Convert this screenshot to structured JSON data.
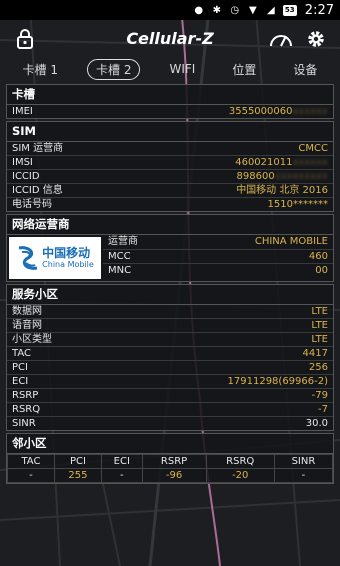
{
  "status_bar": {
    "time": "2:27",
    "battery": "53"
  },
  "app": {
    "title": "Cellular-Z"
  },
  "tabs": [
    {
      "label": "卡槽 1",
      "active": false
    },
    {
      "label": "卡槽 2",
      "active": true
    },
    {
      "label": "WIFI",
      "active": false
    },
    {
      "label": "位置",
      "active": false
    },
    {
      "label": "设备",
      "active": false
    }
  ],
  "slot": {
    "title": "卡槽",
    "imei_label": "IMEI",
    "imei_value": "3555000060",
    "imei_masked": "xxxxxx"
  },
  "sim": {
    "title": "SIM",
    "rows": [
      {
        "label": "SIM 运营商",
        "value": "CMCC",
        "masked": ""
      },
      {
        "label": "IMSI",
        "value": "460021011",
        "masked": "xxxxxx"
      },
      {
        "label": "ICCID",
        "value": "898600",
        "masked": "xxxxxxxxx"
      },
      {
        "label": "ICCID 信息",
        "value": "中国移动 北京 2016",
        "masked": ""
      },
      {
        "label": "电话号码",
        "value": "1510*******",
        "masked": ""
      }
    ]
  },
  "operator": {
    "title": "网络运营商",
    "logo_zh": "中国移动",
    "logo_en": "China Mobile",
    "rows": [
      {
        "label": "运营商",
        "value": "CHINA MOBILE"
      },
      {
        "label": "MCC",
        "value": "460"
      },
      {
        "label": "MNC",
        "value": "00"
      }
    ]
  },
  "serving": {
    "title": "服务小区",
    "rows": [
      {
        "label": "数据网",
        "value": "LTE"
      },
      {
        "label": "语音网",
        "value": "LTE"
      },
      {
        "label": "小区类型",
        "value": "LTE"
      },
      {
        "label": "TAC",
        "value": "4417"
      },
      {
        "label": "PCI",
        "value": "256"
      },
      {
        "label": "ECI",
        "value": "17911298(69966-2)"
      },
      {
        "label": "RSRP",
        "value": "-79"
      },
      {
        "label": "RSRQ",
        "value": "-7"
      },
      {
        "label": "SINR",
        "value": "30.0"
      }
    ]
  },
  "neighbor": {
    "title": "邻小区",
    "headers": [
      "TAC",
      "PCI",
      "ECI",
      "RSRP",
      "RSRQ",
      "SINR"
    ],
    "row": [
      "-",
      "255",
      "-",
      "-96",
      "-20",
      "-"
    ]
  },
  "colors": {
    "accent_value": "#d9b44a",
    "route": "#c77aa8"
  }
}
